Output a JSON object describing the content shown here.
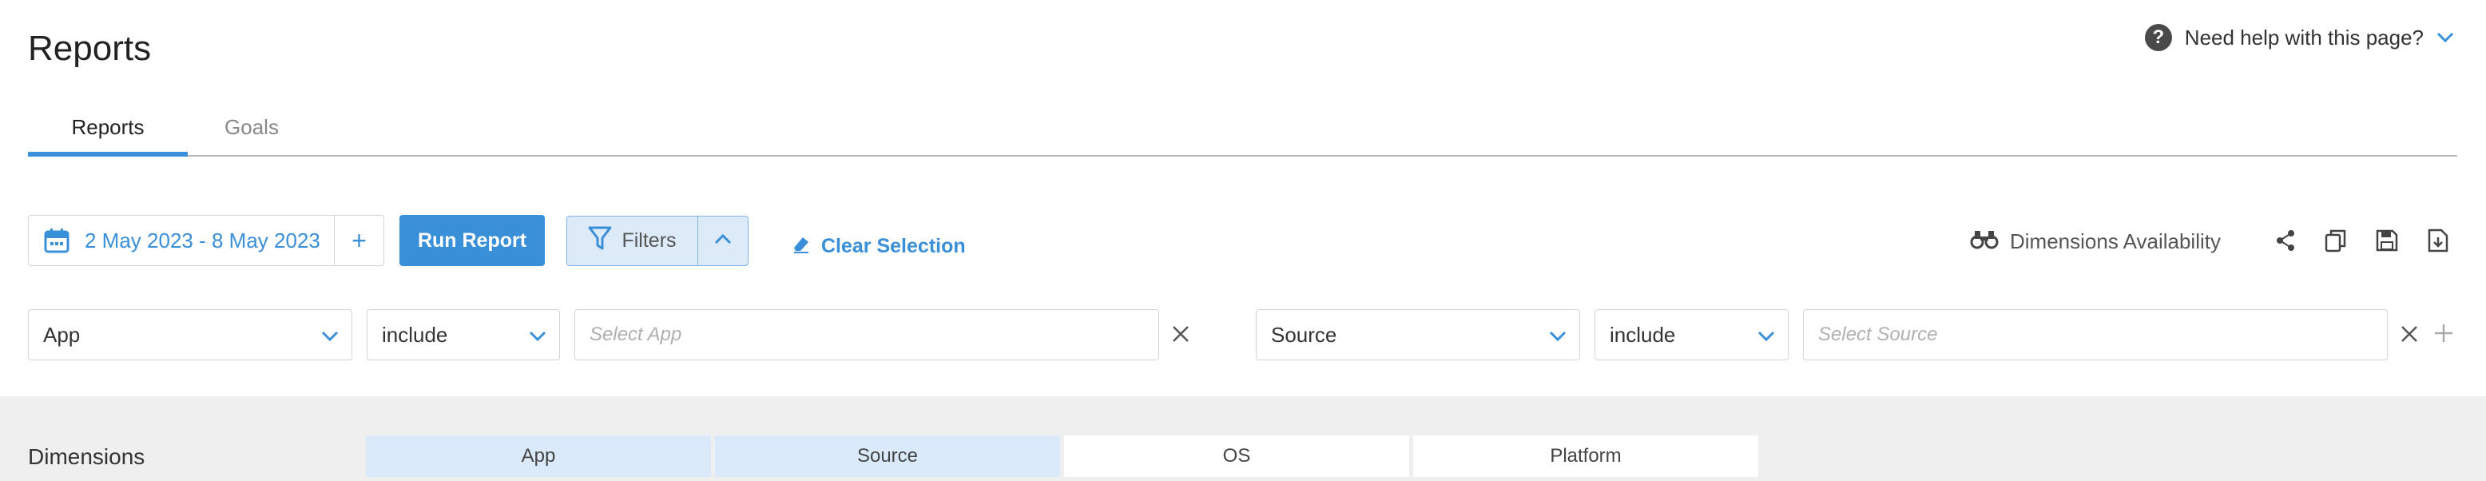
{
  "header": {
    "title": "Reports",
    "help_text": "Need help with this page?"
  },
  "tabs": [
    {
      "label": "Reports",
      "active": true
    },
    {
      "label": "Goals",
      "active": false
    }
  ],
  "toolbar": {
    "date_range": "2 May 2023 - 8 May 2023",
    "run_label": "Run Report",
    "filters_label": "Filters",
    "clear_label": "Clear Selection",
    "dims_availability_label": "Dimensions Availability"
  },
  "filter_rows": [
    {
      "dimension": "App",
      "operator": "include",
      "placeholder": "Select App"
    },
    {
      "dimension": "Source",
      "operator": "include",
      "placeholder": "Select Source"
    }
  ],
  "dimensions": {
    "label": "Dimensions",
    "items": [
      {
        "label": "App",
        "selected": true
      },
      {
        "label": "Source",
        "selected": true
      },
      {
        "label": "OS",
        "selected": false
      },
      {
        "label": "Platform",
        "selected": false
      }
    ]
  },
  "colors": {
    "accent": "#3a8fd9",
    "selected_dim_bg": "#dbeafa",
    "band_bg": "#efefef"
  }
}
